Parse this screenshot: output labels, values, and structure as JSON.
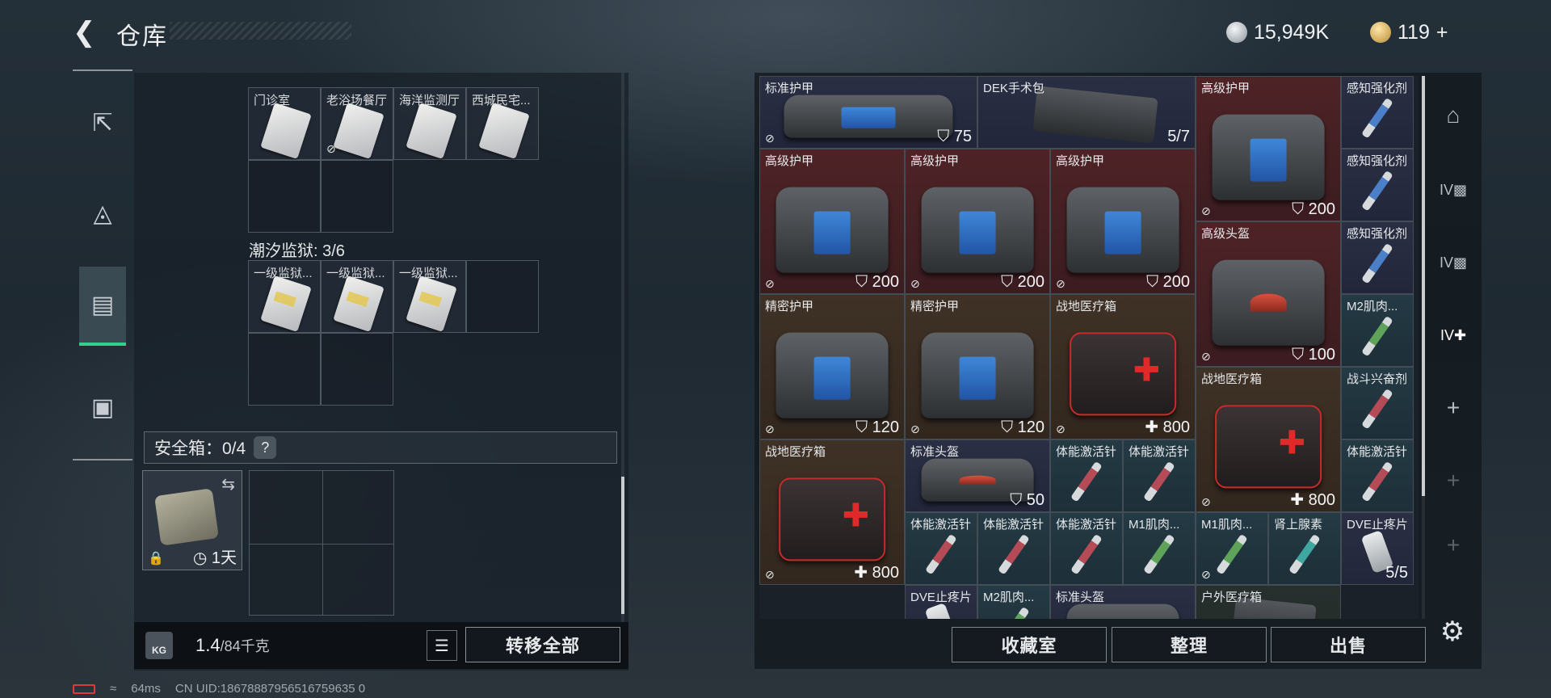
{
  "header": {
    "back_icon": "arrow-left-icon",
    "title": "仓库"
  },
  "currency": {
    "silver": "15,949K",
    "gold": "119",
    "gold_add": "+"
  },
  "left_rail": [
    "pistol-icon",
    "armor-icon",
    "backpack-icon",
    "toolbox-icon"
  ],
  "cards_group1": {
    "items": [
      {
        "label": "门诊室",
        "no_trade": false
      },
      {
        "label": "老浴场餐厅",
        "no_trade": true
      },
      {
        "label": "海洋监测厅",
        "no_trade": false
      },
      {
        "label": "西城民宅...",
        "no_trade": false
      }
    ]
  },
  "cards_group2": {
    "title": "潮汐监狱: 3/6",
    "items": [
      {
        "label": "一级监狱..."
      },
      {
        "label": "一级监狱..."
      },
      {
        "label": "一级监狱..."
      }
    ]
  },
  "safe_box": {
    "label": "安全箱：0/4",
    "help": "?",
    "duration": "1天",
    "swap_icon": "swap-icon",
    "lock_icon": "lock-icon",
    "clock_icon": "clock-icon"
  },
  "footer": {
    "kg_icon": "KG",
    "weight_current": "1.4",
    "weight_max": "/84千克",
    "list_icon": "list-icon",
    "move_all": "转移全部"
  },
  "status_bar": {
    "ping": "64ms",
    "uid": "CN UID:18678887956516759635 0"
  },
  "grid_items": [
    {
      "name": "标准护甲",
      "value": "75",
      "value_icon": "shield",
      "no_trade": true,
      "bg": "b",
      "art": "bag"
    },
    {
      "name": "DEK手术包",
      "value": "5/7",
      "value_icon": "",
      "no_trade": false,
      "bg": "b",
      "art": "kit"
    },
    {
      "name": "高级护甲",
      "value": "200",
      "value_icon": "shield",
      "no_trade": true,
      "bg": "r",
      "art": "bag"
    },
    {
      "name": "感知强化剂",
      "value": "",
      "no_trade": false,
      "bg": "b",
      "art": "syr blu"
    },
    {
      "name": "高级护甲",
      "value": "200",
      "value_icon": "shield",
      "no_trade": true,
      "bg": "r",
      "art": "bag"
    },
    {
      "name": "高级护甲",
      "value": "200",
      "value_icon": "shield",
      "no_trade": true,
      "bg": "r",
      "art": "bag"
    },
    {
      "name": "高级护甲",
      "value": "200",
      "value_icon": "shield",
      "no_trade": true,
      "bg": "r",
      "art": "bag"
    },
    {
      "name": "感知强化剂",
      "value": "",
      "no_trade": false,
      "bg": "b",
      "art": "syr blu"
    },
    {
      "name": "高级头盔",
      "value": "100",
      "value_icon": "shield",
      "no_trade": true,
      "bg": "r",
      "art": "bag helm"
    },
    {
      "name": "感知强化剂",
      "value": "",
      "no_trade": false,
      "bg": "b",
      "art": "syr blu"
    },
    {
      "name": "精密护甲",
      "value": "120",
      "value_icon": "shield",
      "no_trade": true,
      "bg": "br",
      "art": "bag"
    },
    {
      "name": "精密护甲",
      "value": "120",
      "value_icon": "shield",
      "no_trade": true,
      "bg": "br",
      "art": "bag"
    },
    {
      "name": "战地医疗箱",
      "value": "800",
      "value_icon": "plus",
      "no_trade": true,
      "bg": "br",
      "art": "fak"
    },
    {
      "name": "M2肌肉...",
      "value": "",
      "no_trade": false,
      "bg": "t",
      "art": "syr grn"
    },
    {
      "name": "战地医疗箱",
      "value": "800",
      "value_icon": "plus",
      "no_trade": true,
      "bg": "br",
      "art": "fak"
    },
    {
      "name": "战斗兴奋剂",
      "value": "",
      "no_trade": false,
      "bg": "t",
      "art": "syr pink"
    },
    {
      "name": "战地医疗箱",
      "value": "800",
      "value_icon": "plus",
      "no_trade": true,
      "bg": "br",
      "art": "fak"
    },
    {
      "name": "标准头盔",
      "value": "50",
      "value_icon": "shield",
      "no_trade": false,
      "bg": "b",
      "art": "bag helm"
    },
    {
      "name": "体能激活针",
      "value": "",
      "no_trade": false,
      "bg": "t",
      "art": "syr pink"
    },
    {
      "name": "体能激活针",
      "value": "",
      "no_trade": false,
      "bg": "t",
      "art": "syr pink"
    },
    {
      "name": "体能激活针",
      "value": "",
      "no_trade": false,
      "bg": "t",
      "art": "syr pink"
    },
    {
      "name": "体能激活针",
      "value": "",
      "no_trade": false,
      "bg": "t",
      "art": "syr pink"
    },
    {
      "name": "体能激活针",
      "value": "",
      "no_trade": false,
      "bg": "t",
      "art": "syr pink"
    },
    {
      "name": "体能激活针",
      "value": "",
      "no_trade": false,
      "bg": "t",
      "art": "syr pink"
    },
    {
      "name": "M1肌肉...",
      "value": "",
      "no_trade": false,
      "bg": "t",
      "art": "syr grn"
    },
    {
      "name": "M1肌肉...",
      "value": "",
      "no_trade": true,
      "bg": "t",
      "art": "syr grn"
    },
    {
      "name": "肾上腺素",
      "value": "",
      "no_trade": false,
      "bg": "t",
      "art": "syr cyn"
    },
    {
      "name": "DVE止疼片",
      "value": "5/5",
      "value_icon": "",
      "no_trade": false,
      "bg": "b",
      "art": "pill"
    },
    {
      "name": "DVE止疼片",
      "value": "",
      "no_trade": false,
      "bg": "b",
      "art": "pill"
    },
    {
      "name": "M2肌肉...",
      "value": "",
      "no_trade": false,
      "bg": "t",
      "art": "syr grn"
    },
    {
      "name": "标准头盔",
      "value": "",
      "no_trade": false,
      "bg": "b",
      "art": "bag helm"
    },
    {
      "name": "户外医疗箱",
      "value": "",
      "no_trade": false,
      "bg": "g",
      "art": "kit"
    }
  ],
  "right_rail": [
    "hangar-icon",
    "cabinet-iv-icon",
    "cabinet-iv-icon",
    "medkit-iv-add-icon",
    "plus-icon",
    "plus-icon",
    "plus-icon"
  ],
  "actions": {
    "collection": "收藏室",
    "organize": "整理",
    "sell": "出售",
    "settings_icon": "gear-icon"
  }
}
